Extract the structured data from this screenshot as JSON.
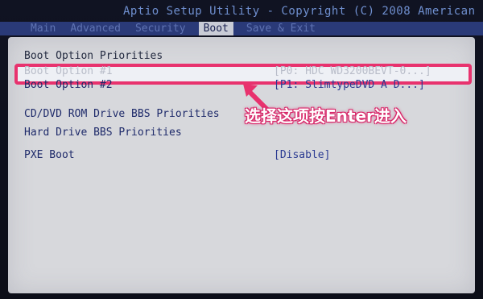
{
  "window": {
    "title": "Aptio Setup Utility - Copyright (C) 2008 American"
  },
  "tabs": [
    {
      "label": "Main"
    },
    {
      "label": "Advanced"
    },
    {
      "label": "Security"
    },
    {
      "label": "Boot"
    },
    {
      "label": "Save & Exit"
    }
  ],
  "boot": {
    "section_title": "Boot Option Priorities",
    "option1": {
      "label": "Boot Option #1",
      "value": "[P0: HDC WD3200BEVT-0...]"
    },
    "option2": {
      "label": "Boot Option #2",
      "value": "[P1: SlimtypeDVD A  D...]"
    },
    "cd_dvd": "CD/DVD ROM Drive BBS Priorities",
    "hdd": "Hard Drive BBS Priorities",
    "pxe": {
      "label": "PXE Boot",
      "value": "[Disable]"
    }
  },
  "annotation": {
    "text": "选择这项按Enter进入",
    "color": "#e8326e"
  }
}
